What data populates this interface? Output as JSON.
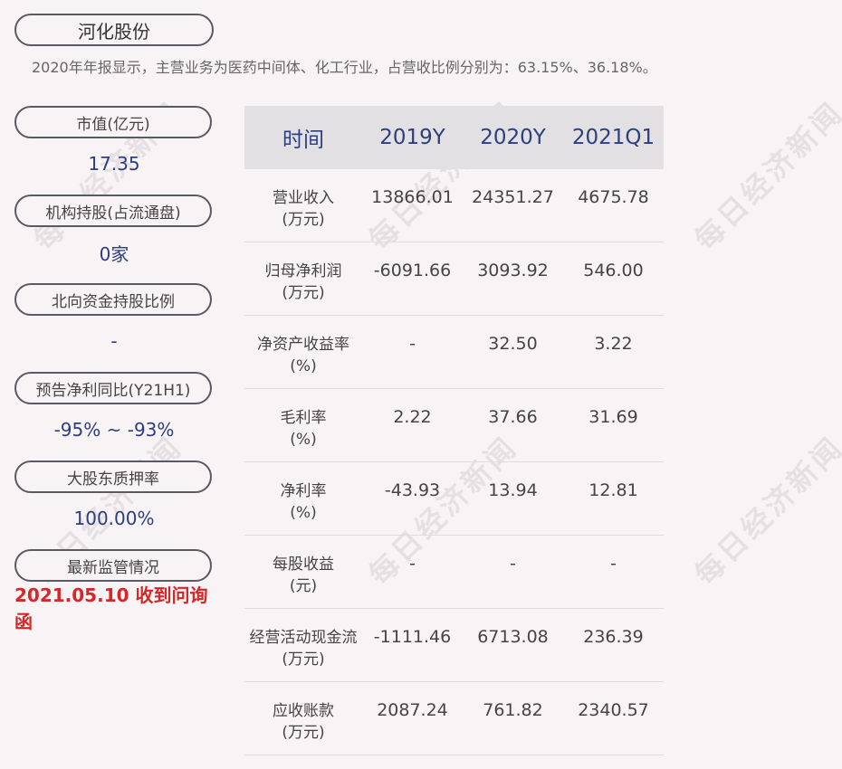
{
  "company": {
    "name": "河化股份"
  },
  "summary": "2020年年报显示，主营业务为医药中间体、化工行业，占营收比例分别为：63.15%、36.18%。",
  "metrics": [
    {
      "label": "市值(亿元)",
      "value": "17.35"
    },
    {
      "label": "机构持股(占流通盘)",
      "value": "0家"
    },
    {
      "label": "北向资金持股比例",
      "value": "-"
    },
    {
      "label": "预告净利同比(Y21H1)",
      "value": "-95% ~ -93%"
    },
    {
      "label": "大股东质押率",
      "value": "100.00%"
    },
    {
      "label": "最新监管情况",
      "value": "2021.05.10 收到问询函"
    }
  ],
  "table": {
    "headers": [
      "时间",
      "2019Y",
      "2020Y",
      "2021Q1"
    ],
    "rows": [
      {
        "label": "营业收入",
        "unit": "(万元)",
        "values": [
          "13866.01",
          "24351.27",
          "4675.78"
        ]
      },
      {
        "label": "归母净利润",
        "unit": "(万元)",
        "values": [
          "-6091.66",
          "3093.92",
          "546.00"
        ]
      },
      {
        "label": "净资产收益率",
        "unit": "(%)",
        "values": [
          "-",
          "32.50",
          "3.22"
        ]
      },
      {
        "label": "毛利率",
        "unit": "(%)",
        "values": [
          "2.22",
          "37.66",
          "31.69"
        ]
      },
      {
        "label": "净利率",
        "unit": "(%)",
        "values": [
          "-43.93",
          "13.94",
          "12.81"
        ]
      },
      {
        "label": "每股收益",
        "unit": "(元)",
        "values": [
          "-",
          "-",
          "-"
        ]
      },
      {
        "label": "经营活动现金流",
        "unit": "(万元)",
        "values": [
          "-1111.46",
          "6713.08",
          "236.39"
        ]
      },
      {
        "label": "应收账款",
        "unit": "(万元)",
        "values": [
          "2087.24",
          "761.82",
          "2340.57"
        ]
      }
    ]
  },
  "watermark": "每日经济新闻",
  "colors": {
    "value_blue": "#2c3e80",
    "alert_red": "#d62728",
    "header_bg": "#e2e0e3",
    "page_bg": "#f8f3f4"
  }
}
